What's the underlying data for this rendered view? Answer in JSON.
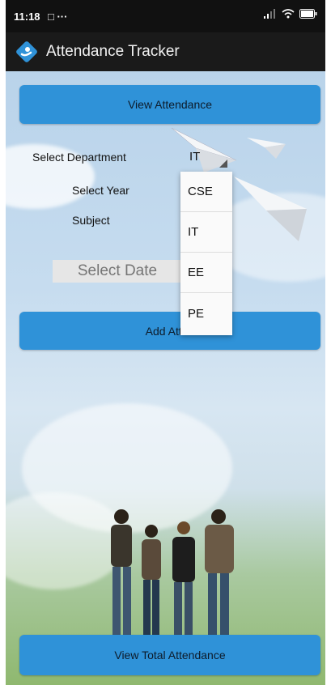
{
  "status_bar": {
    "time": "11:18",
    "extra": "□ ···"
  },
  "app_bar": {
    "title": "Attendance Tracker",
    "logo": "hand-logo"
  },
  "buttons": {
    "view_attendance": "View Attendance",
    "add_attendance": "Add Atten",
    "view_total_attendance": "View Total Attendance"
  },
  "form": {
    "department_label": "Select Department",
    "department_value": "IT",
    "year_label": "Select Year",
    "subject_label": "Subject",
    "date_placeholder": "Select Date"
  },
  "dropdown": {
    "options": [
      "CSE",
      "IT",
      "EE",
      "PE"
    ]
  },
  "colors": {
    "accent": "#2f92d8",
    "appbar": "#1a1a1a"
  }
}
